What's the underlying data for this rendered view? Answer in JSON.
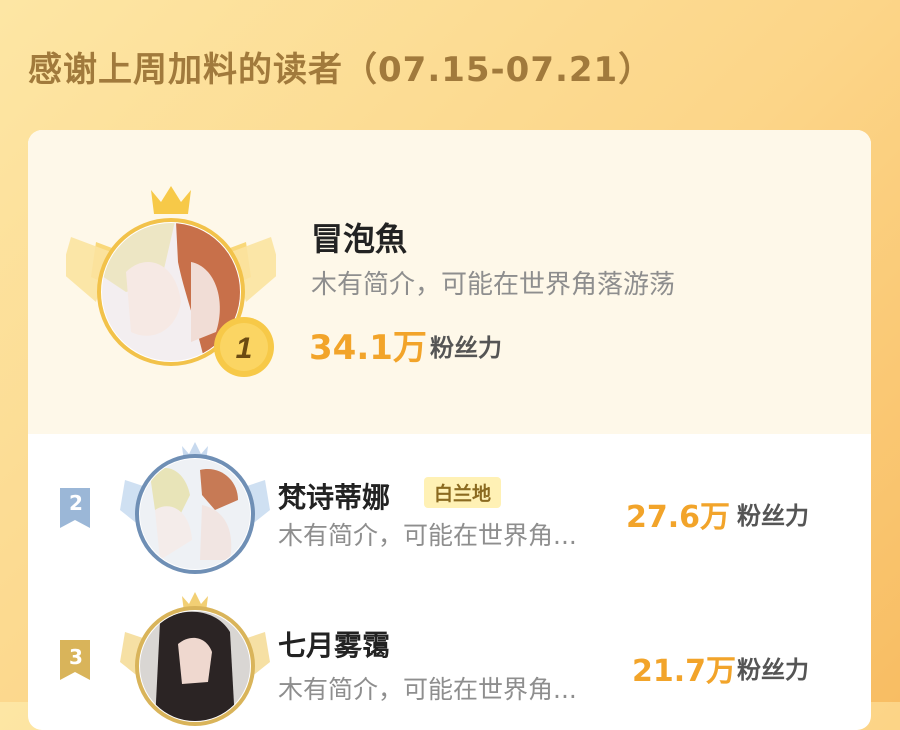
{
  "page": {
    "title": "感谢上周加料的读者（07.15-07.21）"
  },
  "readers": [
    {
      "rank": "1",
      "name": "冒泡魚",
      "bio": "木有简介，可能在世界角落游荡",
      "score": "34.1万",
      "unit": "粉丝力"
    },
    {
      "rank": "2",
      "name": "梵诗蒂娜",
      "badge": "白兰地",
      "bio": "木有简介，可能在世界角...",
      "score": "27.6万",
      "unit": "粉丝力"
    },
    {
      "rank": "3",
      "name": "七月雾霭",
      "bio": "木有简介，可能在世界角...",
      "score": "21.7万",
      "unit": "粉丝力"
    }
  ],
  "colors": {
    "accent": "#f2a42a",
    "gold": "#f7c948",
    "silver": "#9bb7d7",
    "bronze": "#d9b45a",
    "title": "#a17a3c"
  },
  "icons": {
    "crown": "crown-icon",
    "wings": "wing-icon",
    "rank_flag": "rank-flag-icon",
    "medal": "medal-icon"
  }
}
